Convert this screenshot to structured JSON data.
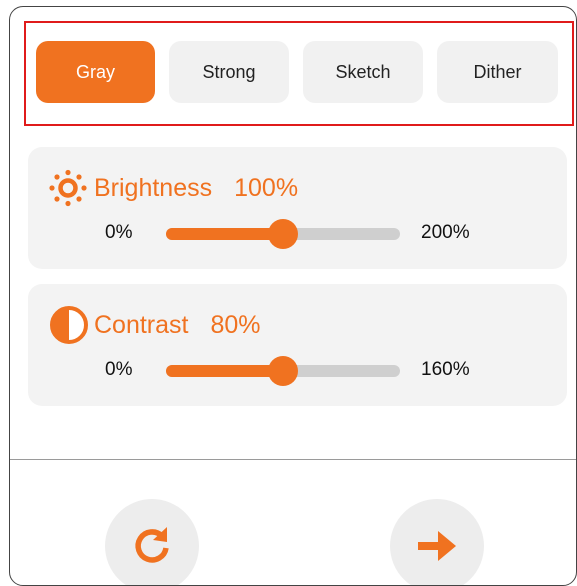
{
  "colors": {
    "accent": "#f07220",
    "highlight_border": "#e01b1b",
    "card_background": "#f3f3f3",
    "button_background": "#f1f1f1",
    "track": "#cfcfcf"
  },
  "filters": [
    {
      "label": "Gray",
      "selected": true
    },
    {
      "label": "Strong",
      "selected": false
    },
    {
      "label": "Sketch",
      "selected": false
    },
    {
      "label": "Dither",
      "selected": false
    }
  ],
  "brightness": {
    "icon": "sun-icon",
    "label": "Brightness",
    "value": "100%",
    "min": "0%",
    "max": "200%",
    "level": 0.5
  },
  "contrast": {
    "icon": "half-circle-icon",
    "label": "Contrast",
    "value": "80%",
    "min": "0%",
    "max": "160%",
    "level": 0.5
  },
  "actions": {
    "reset_icon": "refresh-icon",
    "next_icon": "arrow-right-icon"
  }
}
